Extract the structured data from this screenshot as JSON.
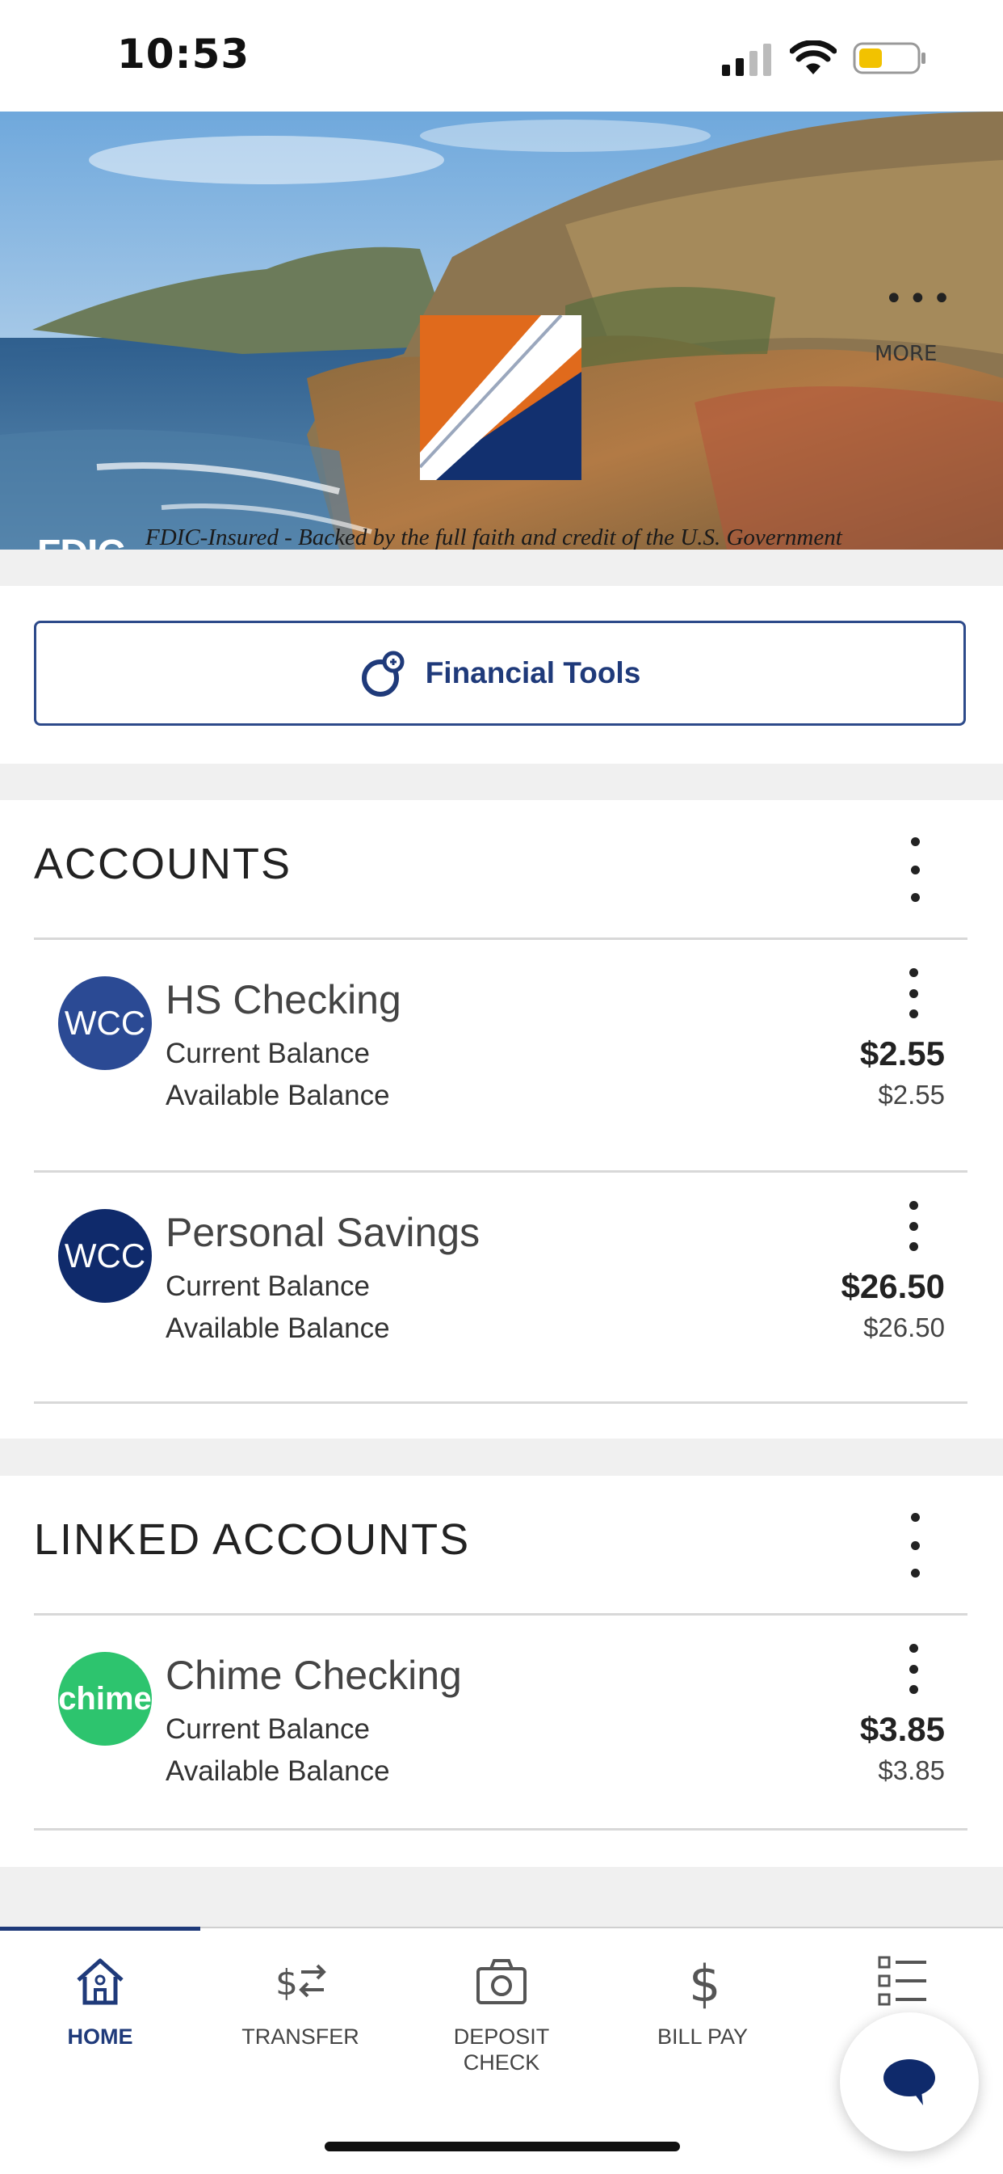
{
  "status_bar": {
    "time": "10:53"
  },
  "hero": {
    "more_label": "MORE",
    "fdic_logo": "FDIC",
    "fdic_notice": "FDIC-Insured - Backed by the full faith and credit of the U.S. Government"
  },
  "tools": {
    "label": "Financial Tools"
  },
  "accounts": {
    "title": "ACCOUNTS",
    "items": [
      {
        "avatar": "WCC",
        "name": "HS Checking",
        "current_label": "Current Balance",
        "available_label": "Available Balance",
        "current": "$2.55",
        "available": "$2.55",
        "avatar_color": "#2b4a94"
      },
      {
        "avatar": "WCC",
        "name": "Personal Savings",
        "current_label": "Current Balance",
        "available_label": "Available Balance",
        "current": "$26.50",
        "available": "$26.50",
        "avatar_color": "#0f2a6b"
      }
    ]
  },
  "linked": {
    "title": "LINKED ACCOUNTS",
    "items": [
      {
        "avatar": "chime",
        "name": "Chime Checking",
        "current_label": "Current Balance",
        "available_label": "Available Balance",
        "current": "$3.85",
        "available": "$3.85",
        "avatar_color": "#2dc46e"
      }
    ]
  },
  "tabs": [
    {
      "label": "HOME",
      "icon": "home-icon",
      "active": true
    },
    {
      "label": "TRANSFER",
      "icon": "transfer-icon",
      "active": false
    },
    {
      "label": "DEPOSIT CHECK",
      "icon": "camera-icon",
      "active": false
    },
    {
      "label": "BILL PAY",
      "icon": "dollar-icon",
      "active": false
    },
    {
      "label": "",
      "icon": "menu-list-icon",
      "active": false
    }
  ],
  "colors": {
    "brand_navy": "#1f3a7a",
    "brand_orange": "#e06a1c",
    "chime_green": "#2dc46e"
  }
}
